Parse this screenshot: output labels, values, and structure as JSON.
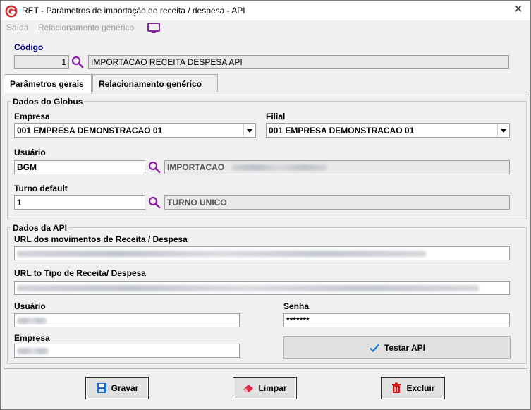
{
  "window": {
    "title": "RET - Parâmetros de importação de receita / despesa - API",
    "close": "✕"
  },
  "menu": {
    "items": [
      "Saída",
      "Relacionamento genérico"
    ]
  },
  "header": {
    "codigo_label": "Código",
    "codigo_value": "1",
    "codigo_desc": "IMPORTACAO RECEITA DESPESA API"
  },
  "tabs": [
    "Parâmetros gerais",
    "Relacionamento genérico"
  ],
  "globus": {
    "title": "Dados do Globus",
    "empresa_label": "Empresa",
    "empresa_value": "001 EMPRESA DEMONSTRACAO 01",
    "filial_label": "Filial",
    "filial_value": "001 EMPRESA DEMONSTRACAO 01",
    "usuario_label": "Usuário",
    "usuario_value": "BGM",
    "usuario_desc": "IMPORTACAO",
    "turno_label": "Turno default",
    "turno_value": "1",
    "turno_desc": "TURNO UNICO"
  },
  "api": {
    "title": "Dados da API",
    "url_mov_label": "URL dos movimentos de Receita / Despesa",
    "url_tipo_label": "URL to Tipo de Receita/ Despesa",
    "usuario_label": "Usuário",
    "senha_label": "Senha",
    "senha_value": "*******",
    "empresa_label": "Empresa",
    "test_button": "Testar API"
  },
  "actions": {
    "save": "Gravar",
    "clear": "Limpar",
    "delete": "Excluir"
  },
  "colors": {
    "purple_icon": "#8b1fa8",
    "label_blue": "#000080",
    "logo_red": "#d22b2b",
    "save_blue": "#1e6fd9",
    "delete_red": "#d01818",
    "check_blue": "#1e78d2"
  },
  "icons": [
    "app-logo",
    "close-icon",
    "monitor-icon",
    "search-icon",
    "check-icon",
    "floppy-icon",
    "eraser-icon",
    "trash-icon"
  ]
}
